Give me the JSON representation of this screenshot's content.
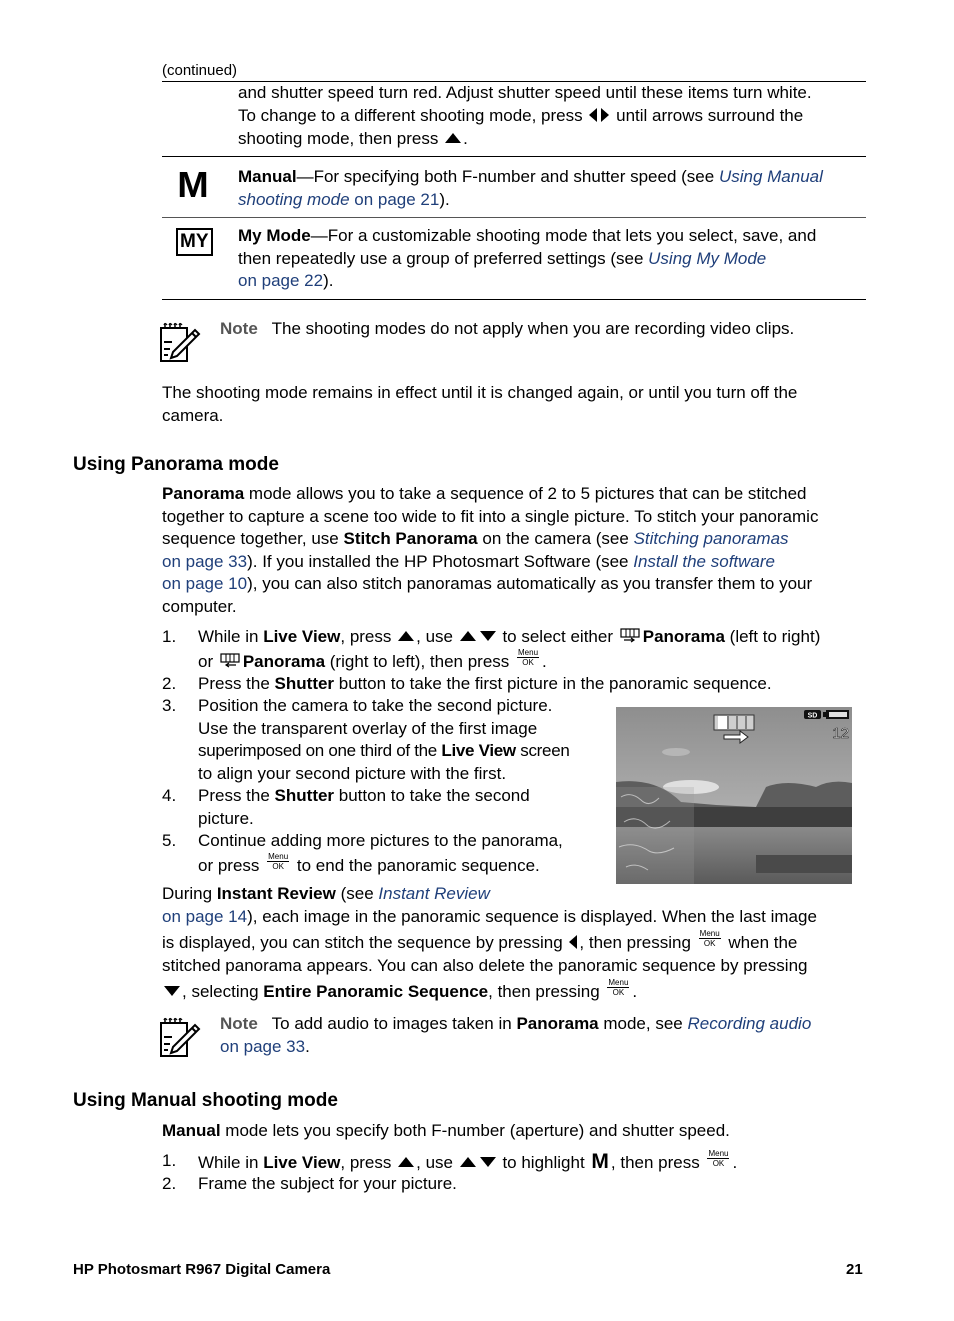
{
  "page": {
    "continued_label": "(continued)",
    "footer_title": "HP Photosmart R967 Digital Camera",
    "page_number": "21"
  },
  "table": {
    "row0": {
      "line1": "and shutter speed turn red. Adjust shutter speed until these items turn white.",
      "line2_a": "To change to a different shooting mode, press",
      "line2_b": "until arrows surround the",
      "line3_a": "shooting mode, then press",
      "line3_b": "."
    },
    "row_manual": {
      "icon_text": "M",
      "term": "Manual",
      "desc": "—For specifying both F-number and shutter speed (see ",
      "link_italic_1": "Using Manual",
      "link_italic_2": "shooting mode",
      "link_page": " on page 21",
      "tail": ")."
    },
    "row_mymode": {
      "icon_text": "MY",
      "term": "My Mode",
      "desc1": "—For a customizable shooting mode that lets you select, save, and",
      "desc2": "then repeatedly use a group of preferred settings (see ",
      "link_italic": "Using My Mode",
      "link_page": "on page 22",
      "tail": ")."
    }
  },
  "note1": {
    "label": "Note",
    "text": "The shooting modes do not apply when you are recording video clips."
  },
  "para_remains": {
    "line1": "The shooting mode remains in effect until it is changed again, or until you turn off the",
    "line2": "camera."
  },
  "panorama_section": {
    "heading": "Using Panorama mode",
    "intro": {
      "l1_bold": "Panorama",
      "l1_rest": " mode allows you to take a sequence of 2 to 5 pictures that can be stitched",
      "l2": "together to capture a scene too wide to fit into a single picture. To stitch your panoramic",
      "l3_a": "sequence together, use ",
      "l3_bold": "Stitch Panorama",
      "l3_b": " on the camera (see ",
      "l3_link": "Stitching panoramas",
      "l4_link": "on page 33",
      "l4_rest": "). If you installed the HP Photosmart Software (see ",
      "l4_link2": "Install the software",
      "l5_link": "on page 10",
      "l5_rest": "), you can also stitch panoramas automatically as you transfer them to your",
      "l6": "computer."
    },
    "steps": [
      {
        "num": "1.",
        "a": "While in ",
        "b_bold": "Live View",
        "c": ", press ",
        "d": ", use ",
        "e": " to select either ",
        "f_bold": "Panorama",
        "g": " (left to right)",
        "h": "or ",
        "i_bold": "Panorama",
        "j": " (right to left), then press ",
        "k": "."
      },
      {
        "num": "2.",
        "a": "Press the ",
        "b_bold": "Shutter",
        "c": " button to take the first picture in the panoramic sequence."
      },
      {
        "num": "3.",
        "l1": "Position the camera to take the second picture.",
        "l2": "Use the transparent overlay of the first image",
        "l3_a": "superimposed on one third of the ",
        "l3_bold": "Live View",
        "l3_b": " screen",
        "l4": "to align your second picture with the first."
      },
      {
        "num": "4.",
        "a": "Press the ",
        "b_bold": "Shutter",
        "c": " button to take the second",
        "l2": "picture."
      },
      {
        "num": "5.",
        "l1": "Continue adding more pictures to the panorama,",
        "l2_a": "or press ",
        "l2_b": " to end the panoramic sequence."
      }
    ],
    "review": {
      "l1_a": "During ",
      "l1_bold": "Instant Review",
      "l1_b": " (see ",
      "l1_link": "Instant Review",
      "l2_link": "on page 14",
      "l2_rest": "), each image in the panoramic sequence is displayed. When the last image",
      "l3_a": "is displayed, you can stitch the sequence by pressing ",
      "l3_b": ", then pressing ",
      "l3_c": " when the",
      "l4": "stitched panorama appears. You can also delete the panoramic sequence by pressing",
      "l5_a": ", selecting ",
      "l5_bold": "Entire Panoramic Sequence",
      "l5_b": ", then pressing ",
      "l5_c": "."
    },
    "note2": {
      "label": "Note",
      "text_a": "To add audio to images taken in ",
      "text_bold": "Panorama",
      "text_b": " mode, see ",
      "link_italic": "Recording audio",
      "link_page": "on page 33",
      "tail": "."
    },
    "photo": {
      "sd_label": "SD",
      "shots_remaining": "12"
    }
  },
  "manual_section": {
    "heading": "Using Manual shooting mode",
    "intro_bold": "Manual",
    "intro_rest": " mode lets you specify both F-number (aperture) and shutter speed.",
    "steps": [
      {
        "num": "1.",
        "a": "While in ",
        "b_bold": "Live View",
        "c": ", press ",
        "d": ", use ",
        "e": " to highlight ",
        "m": "M",
        "f": ", then press ",
        "g": "."
      },
      {
        "num": "2.",
        "text": "Frame the subject for your picture."
      }
    ]
  },
  "button_icon": {
    "menu_top": "Menu",
    "menu_bottom": "OK"
  }
}
